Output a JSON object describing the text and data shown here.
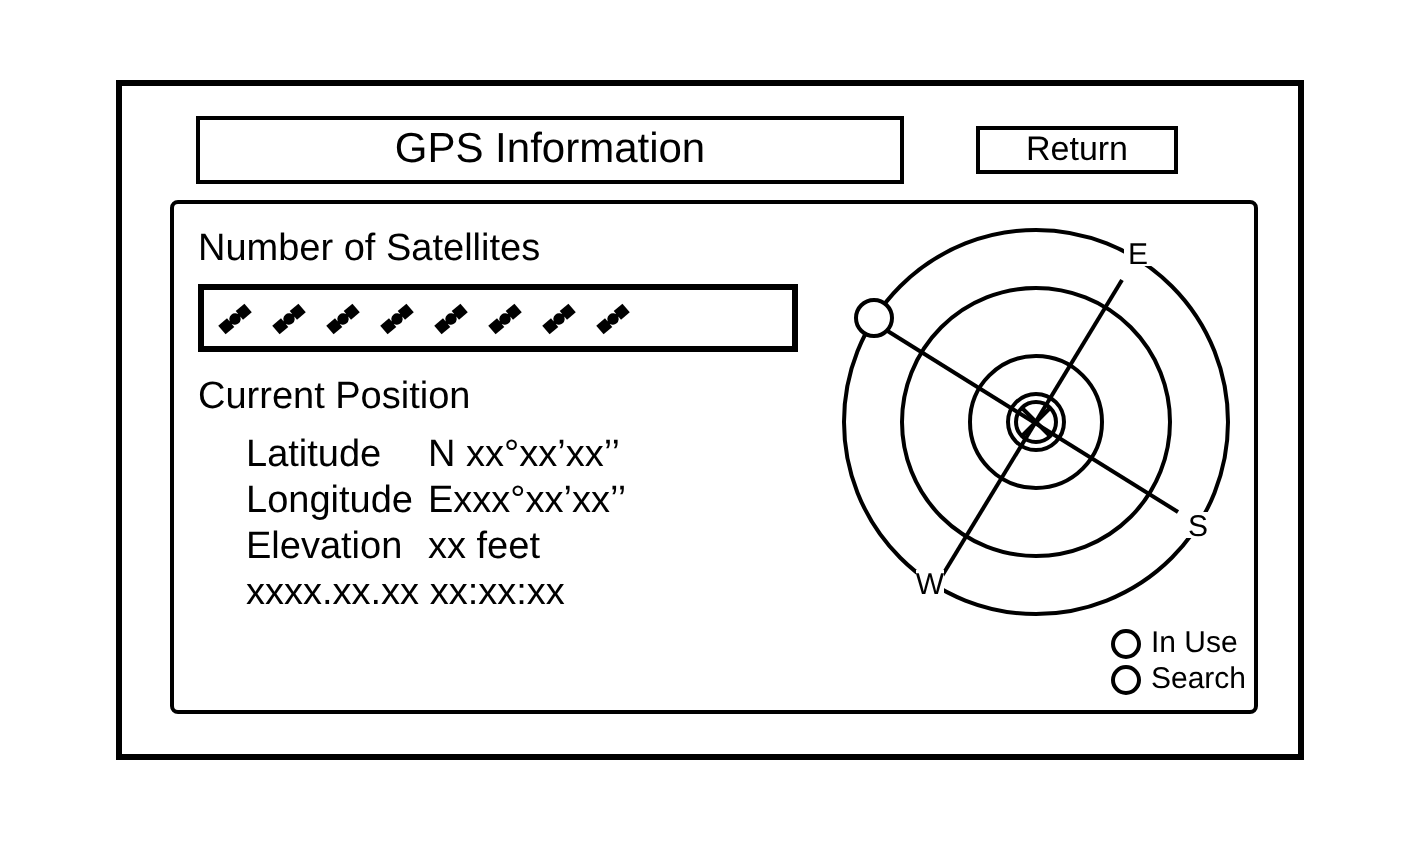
{
  "title": "GPS Information",
  "return_button": "Return",
  "satellites": {
    "label": "Number of Satellites"
  },
  "position": {
    "heading": "Current Position",
    "rows": [
      {
        "label": "Latitude",
        "value": "N xx°xx’xx’’"
      },
      {
        "label": "Longitude",
        "value": "Exxx°xx’xx’’"
      },
      {
        "label": "Elevation",
        "value": "xx feet"
      }
    ],
    "timestamp": "xxxx.xx.xx xx:xx:xx"
  },
  "compass": {
    "labels": [
      {
        "text": "E",
        "kind": "e"
      },
      {
        "text": "S",
        "kind": "s"
      },
      {
        "text": "W",
        "kind": "w"
      }
    ]
  },
  "legend": [
    {
      "label": "In Use"
    },
    {
      "label": "Search"
    }
  ]
}
